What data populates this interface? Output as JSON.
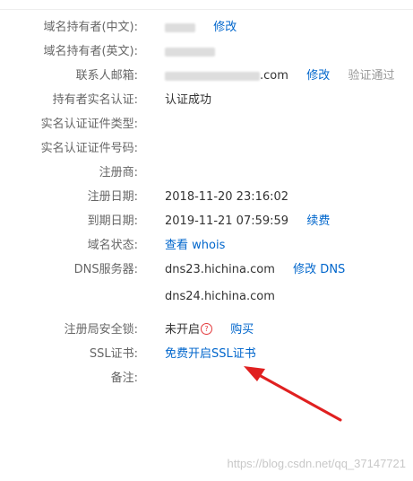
{
  "fields": {
    "holder_cn": {
      "label": "域名持有者(中文):",
      "value": "",
      "action": "修改"
    },
    "holder_en": {
      "label": "域名持有者(英文):",
      "value": ""
    },
    "email": {
      "label": "联系人邮箱:",
      "value": ".com",
      "action": "修改",
      "status": "验证通过"
    },
    "verification": {
      "label": "持有者实名认证:",
      "value": "认证成功"
    },
    "cert_type": {
      "label": "实名认证证件类型:"
    },
    "cert_number": {
      "label": "实名认证证件号码:"
    },
    "registrar": {
      "label": "注册商:"
    },
    "reg_date": {
      "label": "注册日期:",
      "value": "2018-11-20 23:16:02"
    },
    "expire_date": {
      "label": "到期日期:",
      "value": "2019-11-21 07:59:59",
      "action": "续费"
    },
    "status": {
      "label": "域名状态:",
      "action": "查看 whois"
    },
    "dns": {
      "label": "DNS服务器:",
      "value1": "dns23.hichina.com",
      "action": "修改 DNS",
      "value2": "dns24.hichina.com"
    },
    "lock": {
      "label": "注册局安全锁:",
      "value": "未开启",
      "action": "购买"
    },
    "ssl": {
      "label": "SSL证书:",
      "action": "免费开启SSL证书"
    },
    "note": {
      "label": "备注:"
    }
  },
  "icons": {
    "lock_help": "question-circle-icon"
  },
  "colors": {
    "link": "#0066cc",
    "label": "#666666",
    "value": "#333333",
    "muted": "#999999",
    "arrow": "#e02020"
  },
  "watermark": "https://blog.csdn.net/qq_37147721"
}
